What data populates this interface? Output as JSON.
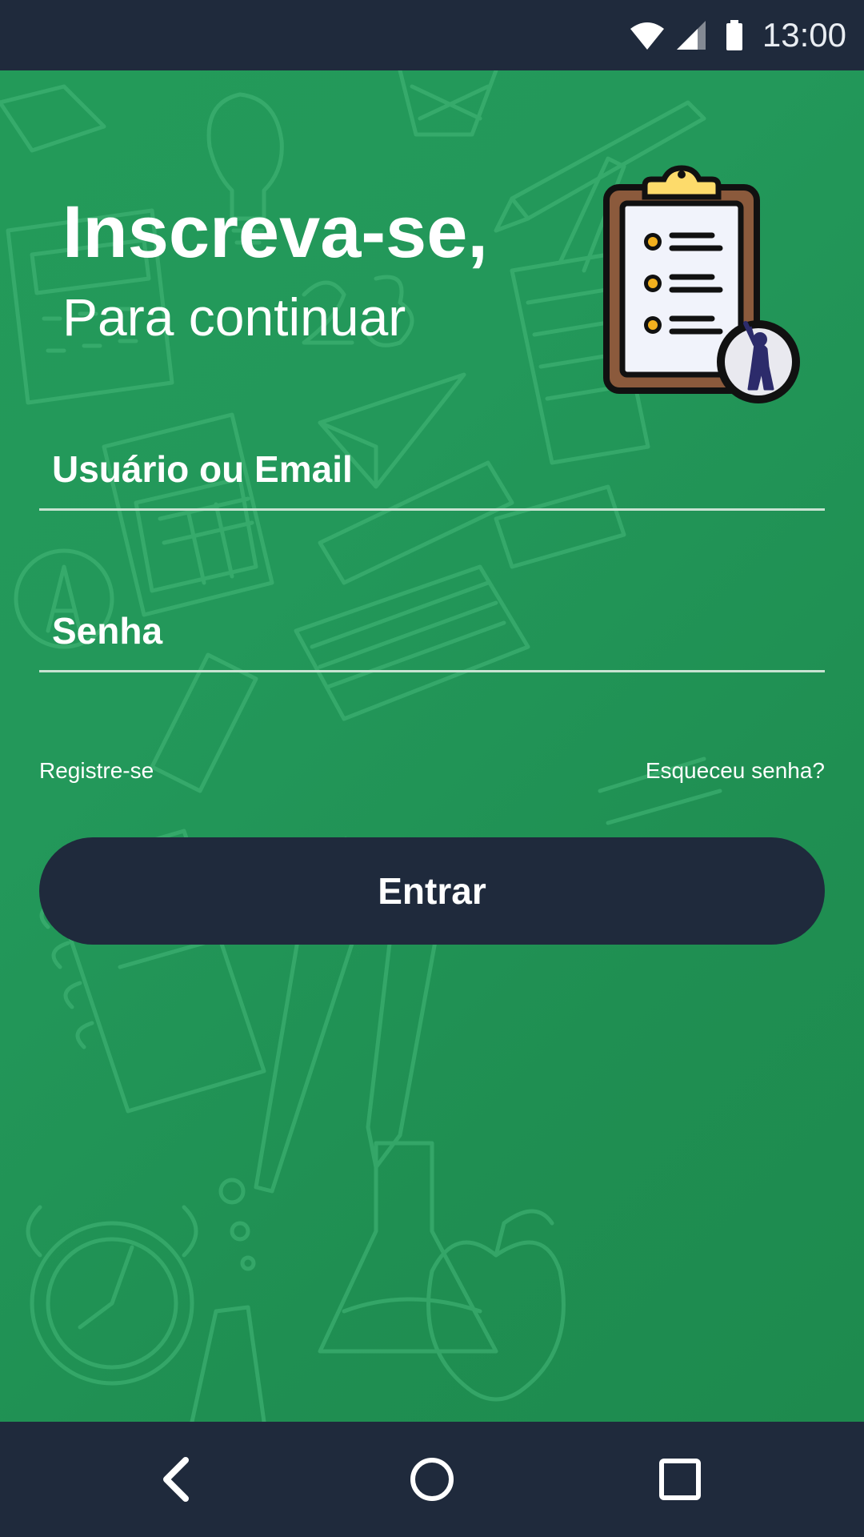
{
  "status_bar": {
    "time": "13:00",
    "icons": [
      "wifi-icon",
      "signal-icon",
      "battery-icon"
    ]
  },
  "header": {
    "title": "Inscreva-se,",
    "subtitle": "Para continuar",
    "illustration": "clipboard-checklist-icon"
  },
  "form": {
    "username_placeholder": "Usuário ou Email",
    "username_value": "",
    "password_placeholder": "Senha",
    "password_value": ""
  },
  "links": {
    "register": "Registre-se",
    "forgot_password": "Esqueceu senha?"
  },
  "actions": {
    "login_label": "Entrar"
  },
  "nav_bar": {
    "icons": [
      "back-icon",
      "home-icon",
      "recents-icon"
    ]
  },
  "colors": {
    "background_green": "#239a59",
    "dark_navy": "#1f2a3c",
    "text": "#ffffff",
    "underline": "#c8e3d2"
  }
}
